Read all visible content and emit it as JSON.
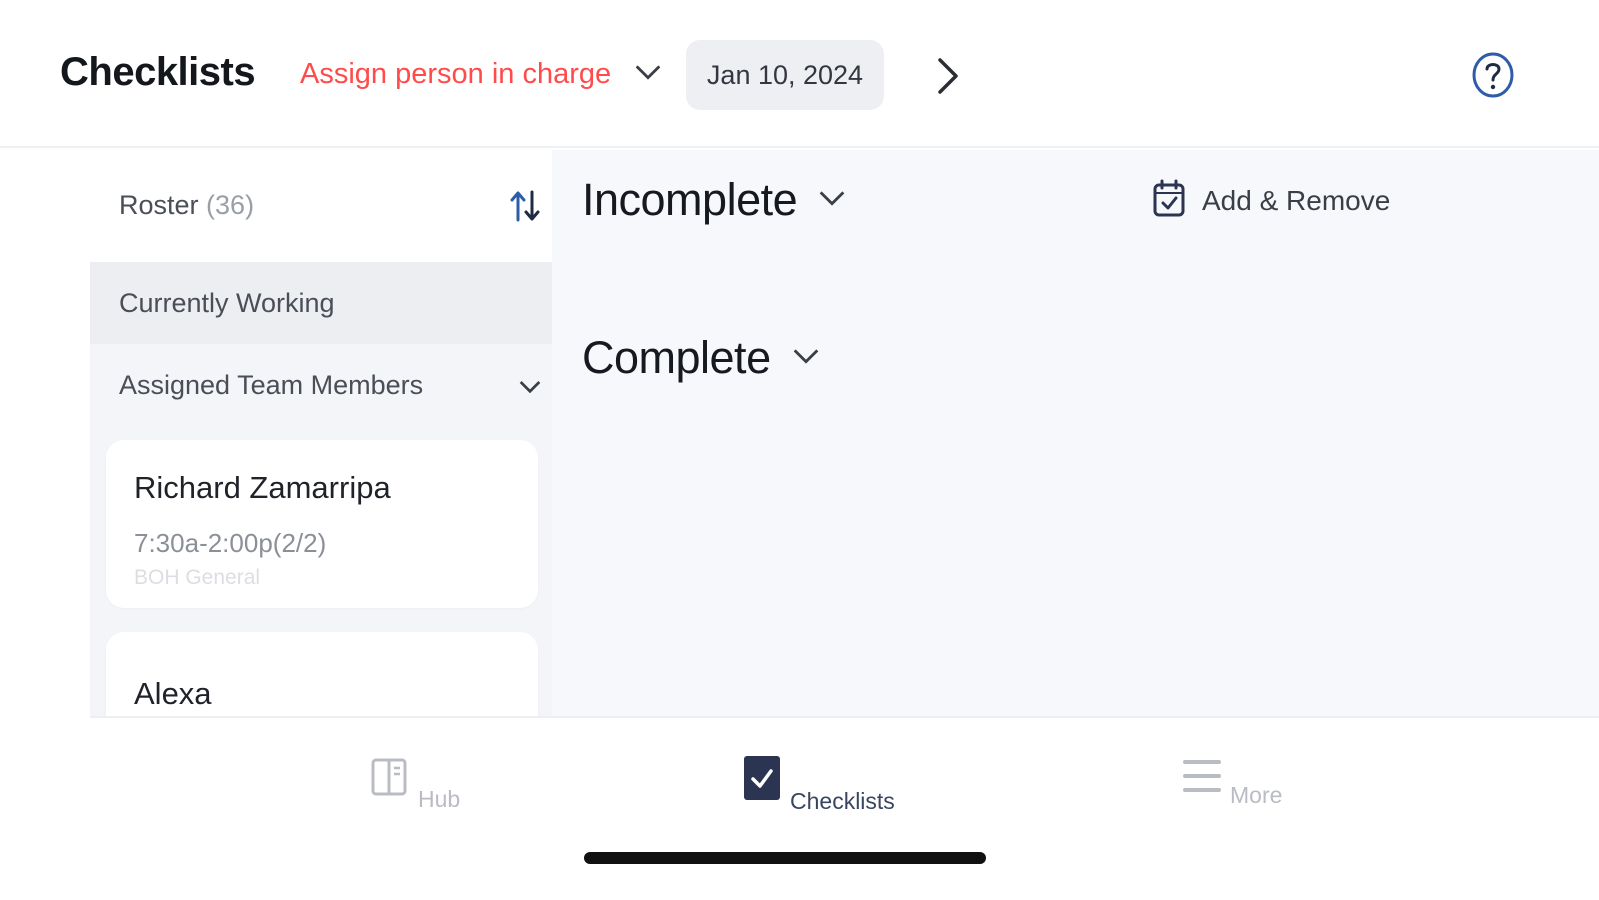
{
  "header": {
    "title": "Checklists",
    "assign_label": "Assign person in charge",
    "date": "Jan 10, 2024"
  },
  "sidebar": {
    "roster_label": "Roster",
    "roster_count": "(36)",
    "currently_working": "Currently Working",
    "assigned_team_members": "Assigned Team Members",
    "members": [
      {
        "name": "Richard Zamarripa",
        "shift": "7:30a-2:00p(2/2)",
        "role": "BOH General"
      },
      {
        "name": "Alexa"
      }
    ]
  },
  "main": {
    "incomplete_label": "Incomplete",
    "complete_label": "Complete",
    "add_remove_label": "Add & Remove"
  },
  "tabbar": {
    "tabs": [
      {
        "label": "Hub",
        "icon": "panel-icon"
      },
      {
        "label": "Checklists",
        "icon": "checkbox-icon"
      },
      {
        "label": "More",
        "icon": "menu-icon"
      }
    ]
  },
  "colors": {
    "accent_red": "#ff4b4b",
    "navy": "#2b3551",
    "blue_icon": "#2d5da8"
  }
}
